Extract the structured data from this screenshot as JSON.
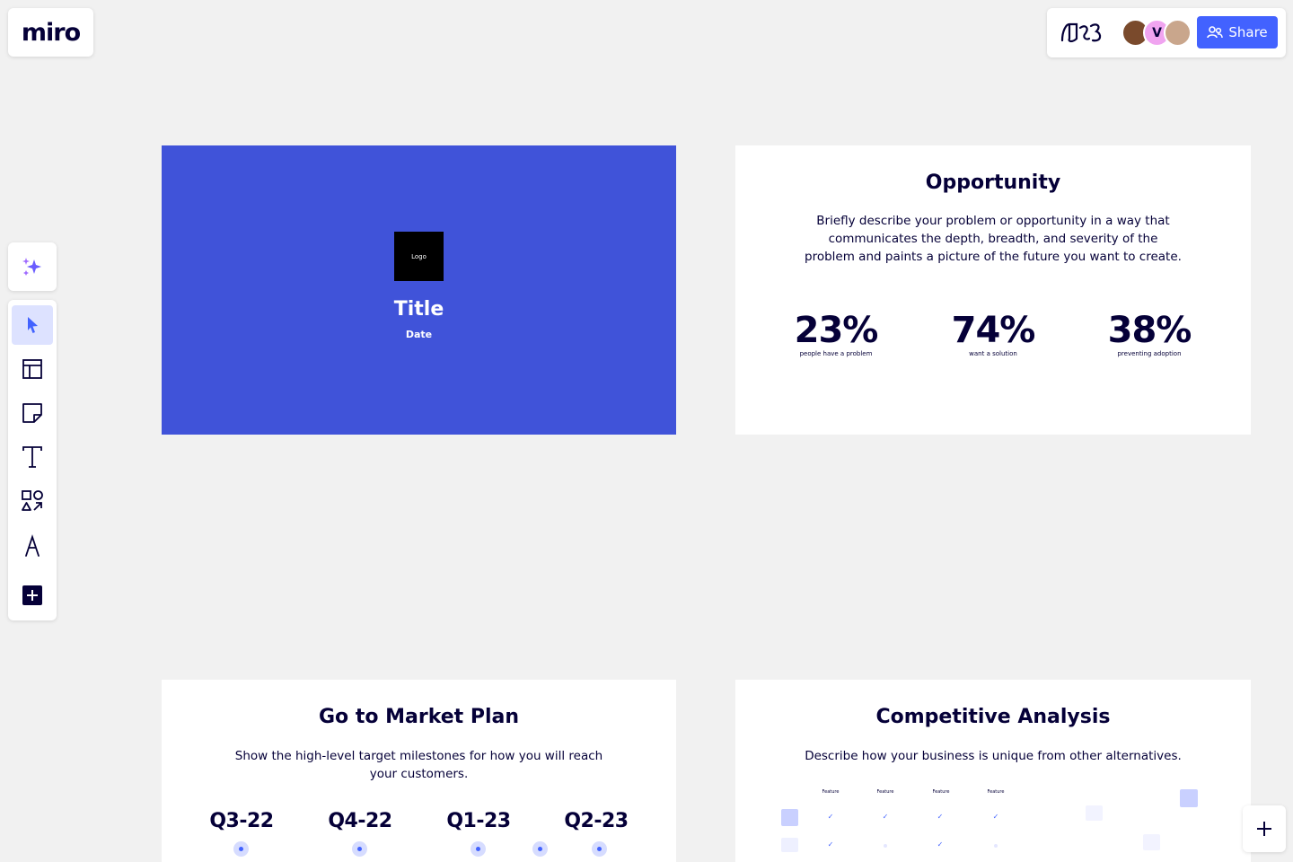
{
  "app": {
    "logo": "miro"
  },
  "topbar": {
    "avatars": [
      {
        "name": "avatar-photo-1",
        "letter": ""
      },
      {
        "name": "avatar-v",
        "letter": "V"
      },
      {
        "name": "avatar-photo-2",
        "letter": ""
      }
    ],
    "share_label": "Share"
  },
  "toolbar": {
    "tools": [
      {
        "name": "select-tool",
        "icon": "cursor-icon",
        "active": true
      },
      {
        "name": "templates-tool",
        "icon": "layout-icon",
        "active": false
      },
      {
        "name": "sticky-note-tool",
        "icon": "sticky-note-icon",
        "active": false
      },
      {
        "name": "text-tool",
        "icon": "text-icon",
        "active": false
      },
      {
        "name": "shapes-tool",
        "icon": "shapes-icon",
        "active": false
      },
      {
        "name": "pen-tool",
        "icon": "pen-icon",
        "active": false
      },
      {
        "name": "more-apps-tool",
        "icon": "plus-square-icon",
        "active": false
      }
    ]
  },
  "frames": {
    "title_slide": {
      "logo_label": "Logo",
      "title": "Title",
      "date": "Date",
      "background": "#4053d9"
    },
    "opportunity": {
      "heading": "Opportunity",
      "description": "Briefly describe your problem or opportunity in a way that communicates the depth, breadth, and severity of the problem and paints a picture of the future you want to create.",
      "stats": [
        {
          "value": "23%",
          "label": "people have a problem"
        },
        {
          "value": "74%",
          "label": "want a solution"
        },
        {
          "value": "38%",
          "label": "preventing adoption"
        }
      ]
    },
    "go_to_market": {
      "heading": "Go to Market Plan",
      "description": "Show the high-level target milestones for how you will reach your customers.",
      "quarters": [
        "Q3-22",
        "Q4-22",
        "Q1-23",
        "Q2-23"
      ]
    },
    "competitive_analysis": {
      "heading": "Competitive Analysis",
      "description": "Describe how your business is unique from other alternatives.",
      "features": [
        "Feature",
        "Feature",
        "Feature",
        "Feature"
      ]
    }
  },
  "colors": {
    "accent": "#4262ff",
    "text": "#050038",
    "canvas": "#f1f1f1"
  }
}
